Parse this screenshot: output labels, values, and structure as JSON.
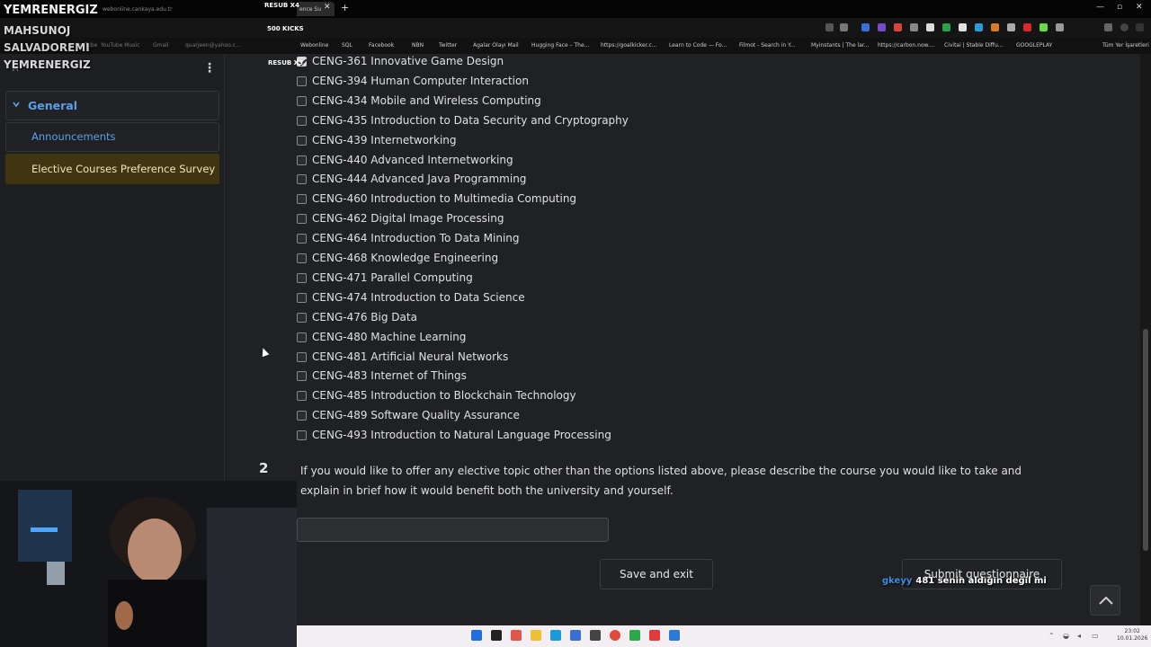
{
  "stream_overlay": {
    "streamer_name": "YEMRENERGIZ",
    "names": [
      "MAHSUNOJ",
      "SALVADOREMI",
      "YEMRENERGIZ"
    ],
    "resub_x4": "RESUB X4",
    "resub_x3": "RESUB X3",
    "kicks": "500 KICKS"
  },
  "browser": {
    "tab_title": "ence Su",
    "url": "webonline.cankaya.edu.tr",
    "bookmarks": [
      "YouTube",
      "YouTube Music",
      "Gmail",
      "quarjeen@yahoo.c...",
      "Webonline",
      "SQL",
      "Facebook",
      "NBN",
      "Twitter",
      "Agalar Olayı Mail",
      "Hugging Face – The...",
      "https://goalkicker.c...",
      "Learn to Code — Fo...",
      "Filmot - Search in Y...",
      "Myinstants | The lar...",
      "https://carbon.now....",
      "Civitai | Stable Diffu...",
      "GOOGLEPLAY",
      "Tüm Yer İşaretleri"
    ]
  },
  "sidebar": {
    "section": "General",
    "items": [
      {
        "label": "Announcements",
        "active": false
      },
      {
        "label": "Elective Courses Preference Survey",
        "active": true
      }
    ]
  },
  "question1": {
    "options": [
      {
        "label": "CENG-361 Innovative Game Design",
        "checked": true
      },
      {
        "label": "CENG-394 Human Computer Interaction",
        "checked": false
      },
      {
        "label": "CENG-434 Mobile and Wireless Computing",
        "checked": false
      },
      {
        "label": "CENG-435 Introduction to Data Security and Cryptography",
        "checked": false
      },
      {
        "label": "CENG-439 Internetworking",
        "checked": false
      },
      {
        "label": "CENG-440 Advanced Internetworking",
        "checked": false
      },
      {
        "label": "CENG-444 Advanced Java Programming",
        "checked": false
      },
      {
        "label": "CENG-460 Introduction to Multimedia Computing",
        "checked": false
      },
      {
        "label": "CENG-462 Digital Image Processing",
        "checked": false
      },
      {
        "label": "CENG-464 Introduction To Data Mining",
        "checked": false
      },
      {
        "label": "CENG-468 Knowledge Engineering",
        "checked": false
      },
      {
        "label": "CENG-471 Parallel Computing",
        "checked": false
      },
      {
        "label": "CENG-474 Introduction to Data Science",
        "checked": false
      },
      {
        "label": "CENG-476 Big Data",
        "checked": false
      },
      {
        "label": "CENG-480 Machine Learning",
        "checked": false
      },
      {
        "label": "CENG-481 Artificial Neural Networks",
        "checked": false
      },
      {
        "label": "CENG-483 Internet of Things",
        "checked": false
      },
      {
        "label": "CENG-485 Introduction to Blockchain Technology",
        "checked": false
      },
      {
        "label": "CENG-489 Software Quality Assurance",
        "checked": false
      },
      {
        "label": "CENG-493 Introduction to Natural Language Processing",
        "checked": false
      }
    ]
  },
  "question2": {
    "number": "2",
    "text": "If you would like to offer any elective topic other than the options listed above, please describe the course you would like to take and explain in brief how it would benefit both the university and yourself.",
    "answer_value": ""
  },
  "actions": {
    "save_label": "Save and exit",
    "submit_label": "Submit questionnaire"
  },
  "chat": {
    "user": "gkeyy",
    "message": "481 senin aldığın değil mi"
  },
  "taskbar": {
    "time": "23:02",
    "date": "10.01.2026"
  }
}
